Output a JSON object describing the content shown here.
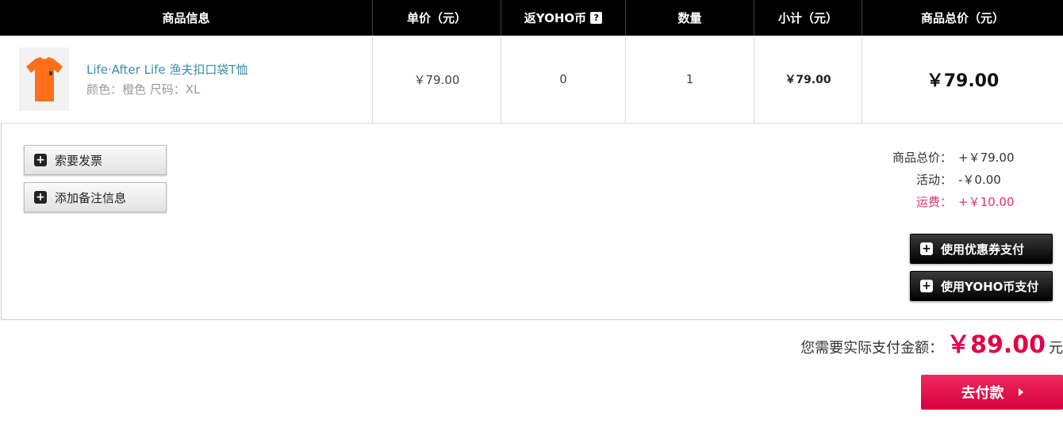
{
  "header": {
    "col_product": "商品信息",
    "col_unit_price": "单价（元）",
    "col_yoho_coin": "返YOHO币",
    "col_quantity": "数量",
    "col_subtotal": "小计（元）",
    "col_total": "商品总价（元）"
  },
  "item": {
    "name": "Life·After Life 渔夫扣口袋T恤",
    "attrs": "颜色：橙色 尺码：XL",
    "unit_price": "￥79.00",
    "yoho_coin": "0",
    "quantity": "1",
    "subtotal": "￥79.00",
    "total": "￥79.00",
    "image_color": "#ff6f1a"
  },
  "actions": {
    "invoice_label": "索要发票",
    "remark_label": "添加备注信息",
    "coupon_label": "使用优惠券支付",
    "yoho_coin_label": "使用YOHO币支付"
  },
  "summary": {
    "goods_total_label": "商品总价：",
    "goods_total_value": "+￥79.00",
    "activity_label": "活动：",
    "activity_value": "-￥0.00",
    "shipping_label": "运费：",
    "shipping_value": "+￥10.00",
    "pay_label": "您需要实际支付金额：",
    "pay_amount": "￥89.00",
    "pay_unit": "元"
  },
  "checkout": {
    "pay_button": "去付款"
  },
  "colors": {
    "accent": "#e3004a",
    "link": "#3a8da8",
    "header_bg": "#000000"
  }
}
